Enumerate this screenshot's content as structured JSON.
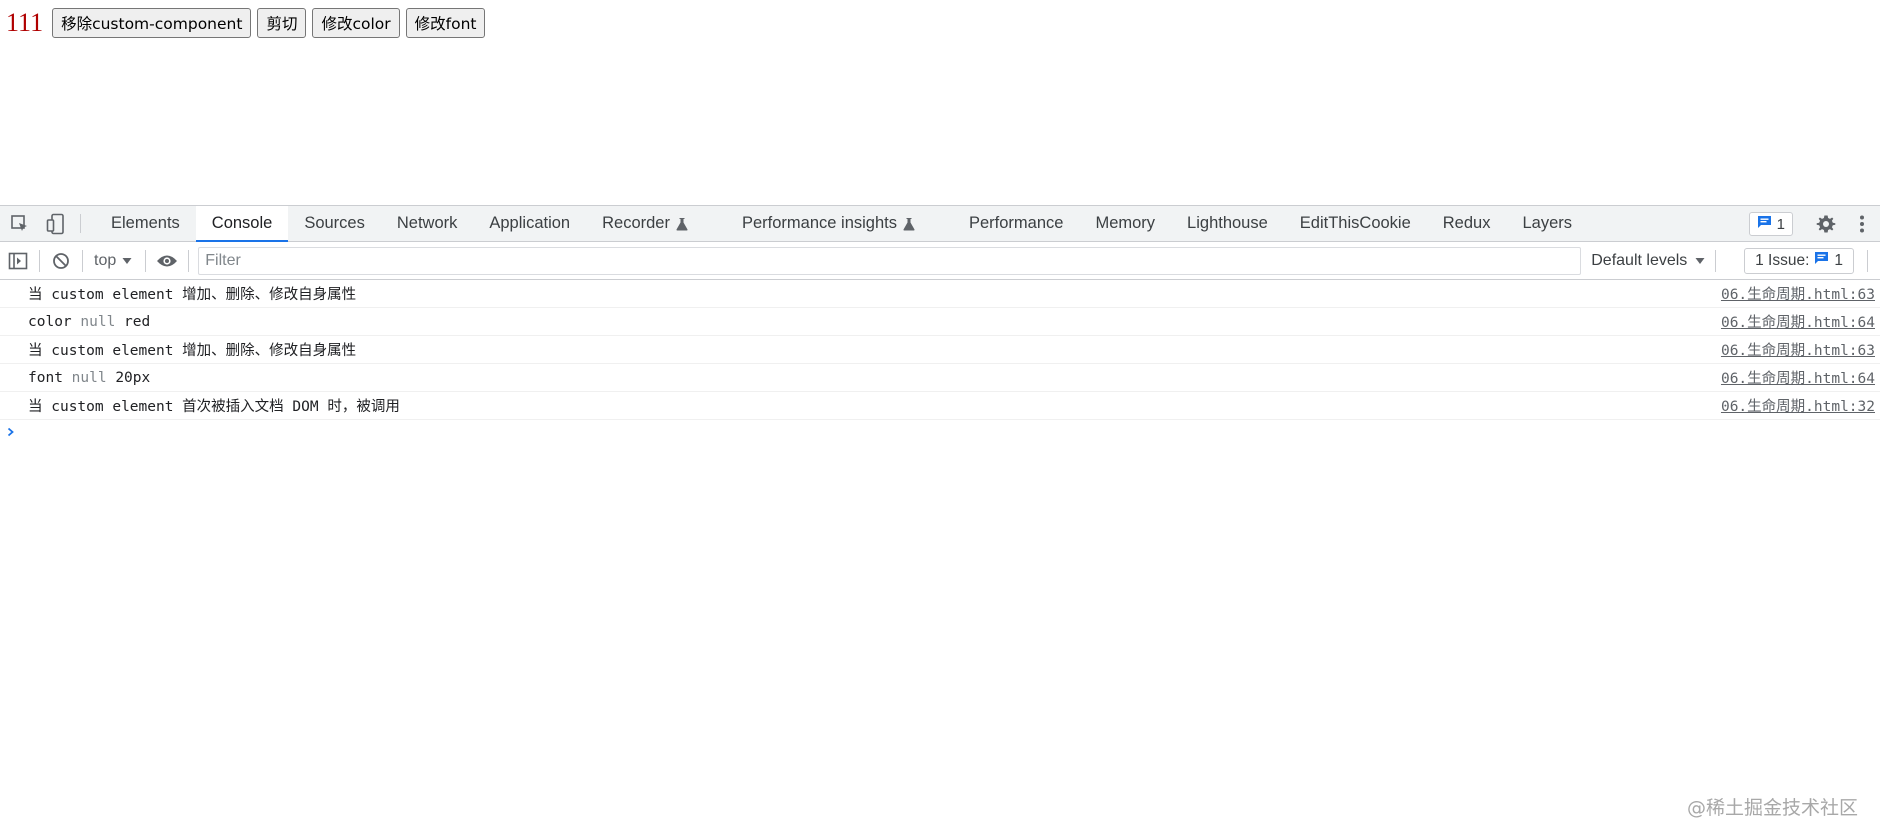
{
  "page": {
    "text": "111",
    "buttons": [
      "移除custom-component",
      "剪切",
      "修改color",
      "修改font"
    ]
  },
  "devtools": {
    "tabs": [
      {
        "label": "Elements",
        "active": false
      },
      {
        "label": "Console",
        "active": true
      },
      {
        "label": "Sources",
        "active": false
      },
      {
        "label": "Network",
        "active": false
      },
      {
        "label": "Application",
        "active": false
      },
      {
        "label": "Recorder",
        "active": false,
        "icon": "flask-icon"
      },
      {
        "label": "Performance insights",
        "active": false,
        "icon": "flask-icon"
      },
      {
        "label": "Performance",
        "active": false
      },
      {
        "label": "Memory",
        "active": false
      },
      {
        "label": "Lighthouse",
        "active": false
      },
      {
        "label": "EditThisCookie",
        "active": false
      },
      {
        "label": "Redux",
        "active": false
      },
      {
        "label": "Layers",
        "active": false
      }
    ],
    "message_badge_count": "1",
    "console": {
      "context": "top",
      "filter_placeholder": "Filter",
      "levels_label": "Default levels",
      "issues_label": "1 Issue:",
      "issues_count": "1",
      "messages": [
        {
          "parts": [
            "当 custom element 增加、删除、修改自身属性"
          ],
          "source": "06.生命周期.html:63"
        },
        {
          "parts": [
            "color",
            "null",
            "red"
          ],
          "source": "06.生命周期.html:64"
        },
        {
          "parts": [
            "当 custom element 增加、删除、修改自身属性"
          ],
          "source": "06.生命周期.html:63"
        },
        {
          "parts": [
            "font",
            "null",
            "20px"
          ],
          "source": "06.生命周期.html:64"
        },
        {
          "parts": [
            "当 custom element 首次被插入文档 DOM 时，被调用"
          ],
          "source": "06.生命周期.html:32"
        }
      ]
    }
  },
  "watermark": "@稀土掘金技术社区",
  "colors": {
    "accent": "#1a73e8",
    "page_text": "#b00000",
    "tabbar_bg": "#f1f3f4"
  }
}
